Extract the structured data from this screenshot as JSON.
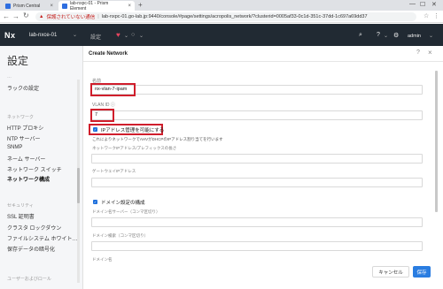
{
  "browser": {
    "tabs": [
      {
        "label": "Prism Central"
      },
      {
        "label": "lab-nxpc-01 - Prism Element"
      }
    ],
    "new_tab": "+",
    "security_warning": "保護されていない通信",
    "url": "lab-nxpc-01.go-lab.jp:9440/console/#page/settings/acropolis_network/?clusterid=0005af33-0c1d-351c-37dd-1c697a69dd37"
  },
  "header": {
    "logo": "Nx",
    "cluster_name": "lab-nxce-01",
    "settings_label": "設定",
    "help": "?",
    "user": "admin"
  },
  "sidebar": {
    "title": "設定",
    "items": [
      {
        "label": "ラックの設定",
        "section": false,
        "selected": false
      },
      {
        "label": "ネットワーク",
        "section": true,
        "selected": false
      },
      {
        "label": "HTTP プロキシ",
        "section": false,
        "selected": false
      },
      {
        "label": "NTP サーバー",
        "section": false,
        "selected": false
      },
      {
        "label": "SNMP",
        "section": false,
        "selected": false
      },
      {
        "label": "ネーム サーバー",
        "section": false,
        "selected": false
      },
      {
        "label": "ネットワーク スイッチ",
        "section": false,
        "selected": false
      },
      {
        "label": "ネットワーク構成",
        "section": false,
        "selected": true
      },
      {
        "label": "セキュリティ",
        "section": true,
        "selected": false
      },
      {
        "label": "SSL 証明書",
        "section": false,
        "selected": false
      },
      {
        "label": "クラスタ ロックダウン",
        "section": false,
        "selected": false
      },
      {
        "label": "ファイルシステム ホワイト…",
        "section": false,
        "selected": false
      },
      {
        "label": "保存データの暗号化",
        "section": false,
        "selected": false
      },
      {
        "label": "ユーザーおよびロール",
        "section": true,
        "selected": false
      }
    ]
  },
  "modal": {
    "title": "Create Network",
    "name_label": "名前",
    "name_value": "nx-vlan-7-ipam",
    "vlan_label": "VLAN ID ⓘ",
    "vlan_value": "7",
    "ip_mgmt_checkbox": "IPアドレス管理を可能にする",
    "ip_mgmt_note": "これによりネットワークでAHVがDHCPのIPアドレス割り当てを行います",
    "network_ip_label": "ネットワークIPアドレス/プレフィックスの長さ",
    "gateway_label": "ゲートウェイIPアドレス",
    "domain_checkbox": "ドメイン設定の構成",
    "dns_label": "ドメイン名サーバー（コンマ区切り）",
    "search_label": "ドメイン検索（コンマ区切り）",
    "domain_name_label": "ドメイン名",
    "cancel": "キャンセル",
    "save": "保存"
  },
  "colors": {
    "header_bg": "#212a33",
    "accent": "#2a7de1",
    "highlight": "#d01e2c"
  }
}
